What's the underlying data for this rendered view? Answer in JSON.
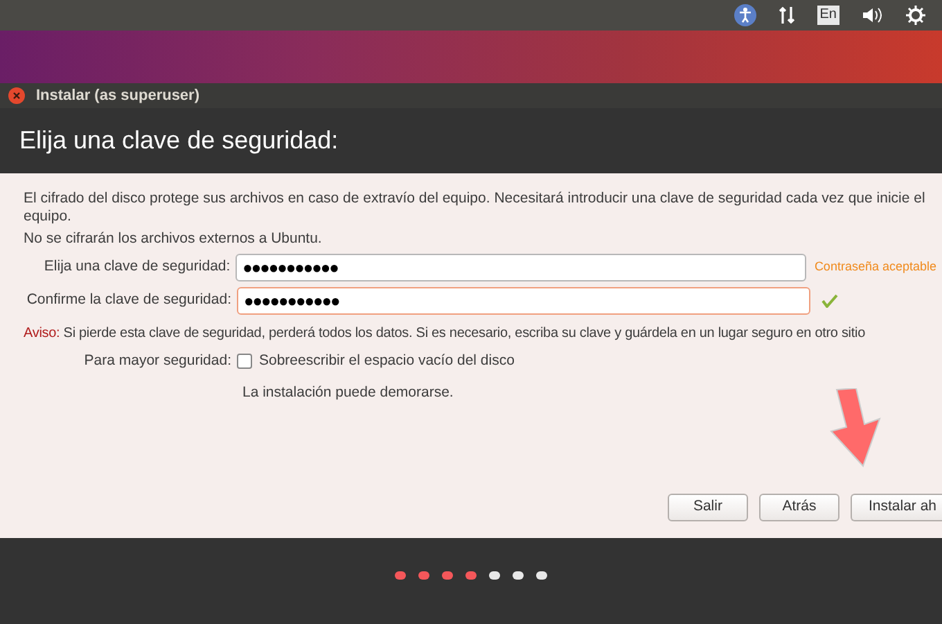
{
  "top_panel": {
    "keyboard_layout": "En"
  },
  "window": {
    "title": "Instalar (as superuser)",
    "heading": "Elija una clave de seguridad:"
  },
  "intro": [
    "El cifrado del disco protege sus archivos en caso de extravío del equipo. Necesitará introducir una clave de seguridad cada vez que inicie el equipo.",
    "No se cifrarán los archivos externos a Ubuntu."
  ],
  "fields": [
    {
      "label": "Elija una clave de seguridad:",
      "value": "●●●●●●●●●●●",
      "focused": false,
      "hint": "Contraseña aceptable",
      "matched": false
    },
    {
      "label": "Confirme la clave de seguridad:",
      "value": "●●●●●●●●●●●",
      "focused": true,
      "matched": true
    }
  ],
  "warning": {
    "label": "Aviso:",
    "text": "Si pierde esta clave de seguridad, perderá todos los datos. Si es necesario, escriba su clave y guárdela en un lugar seguro en otro sitio"
  },
  "extra_security": {
    "label": "Para mayor seguridad:",
    "option": "Sobreescribir el espacio vacío del disco",
    "checked": false,
    "note": "La instalación puede demorarse."
  },
  "buttons": [
    "Salir",
    "Atrás",
    "Instalar ah"
  ],
  "progress_steps": [
    {
      "done": true
    },
    {
      "done": true
    },
    {
      "done": true
    },
    {
      "done": true
    },
    {
      "done": false
    },
    {
      "done": false
    },
    {
      "done": false
    }
  ]
}
